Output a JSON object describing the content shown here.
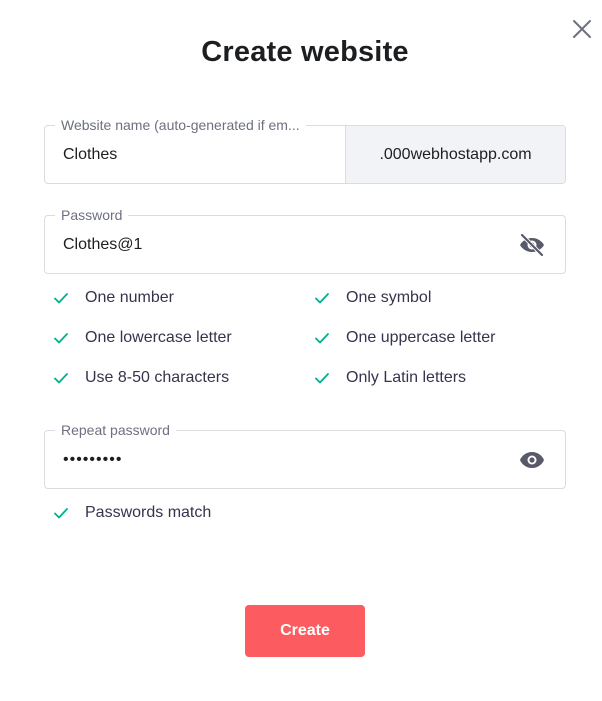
{
  "dialog": {
    "title": "Create website",
    "close_icon": "close-icon"
  },
  "website_name": {
    "label": "Website name (auto-generated if em...",
    "value": "Clothes",
    "domain_suffix": ".000webhostapp.com"
  },
  "password": {
    "label": "Password",
    "value": "Clothes@1",
    "visibility_icon": "eye-off-icon"
  },
  "requirements": [
    {
      "label": "One number",
      "met": true
    },
    {
      "label": "One symbol",
      "met": true
    },
    {
      "label": "One lowercase letter",
      "met": true
    },
    {
      "label": "One uppercase letter",
      "met": true
    },
    {
      "label": "Use 8-50 characters",
      "met": true
    },
    {
      "label": "Only Latin letters",
      "met": true
    }
  ],
  "repeat_password": {
    "label": "Repeat password",
    "value": "•••••••••",
    "visibility_icon": "eye-icon"
  },
  "match_status": {
    "label": "Passwords match",
    "met": true
  },
  "create_button": {
    "label": "Create"
  },
  "colors": {
    "accent": "#fc5b5f",
    "check": "#00b090",
    "title": "#1d1e20",
    "icon": "#585a6a"
  }
}
